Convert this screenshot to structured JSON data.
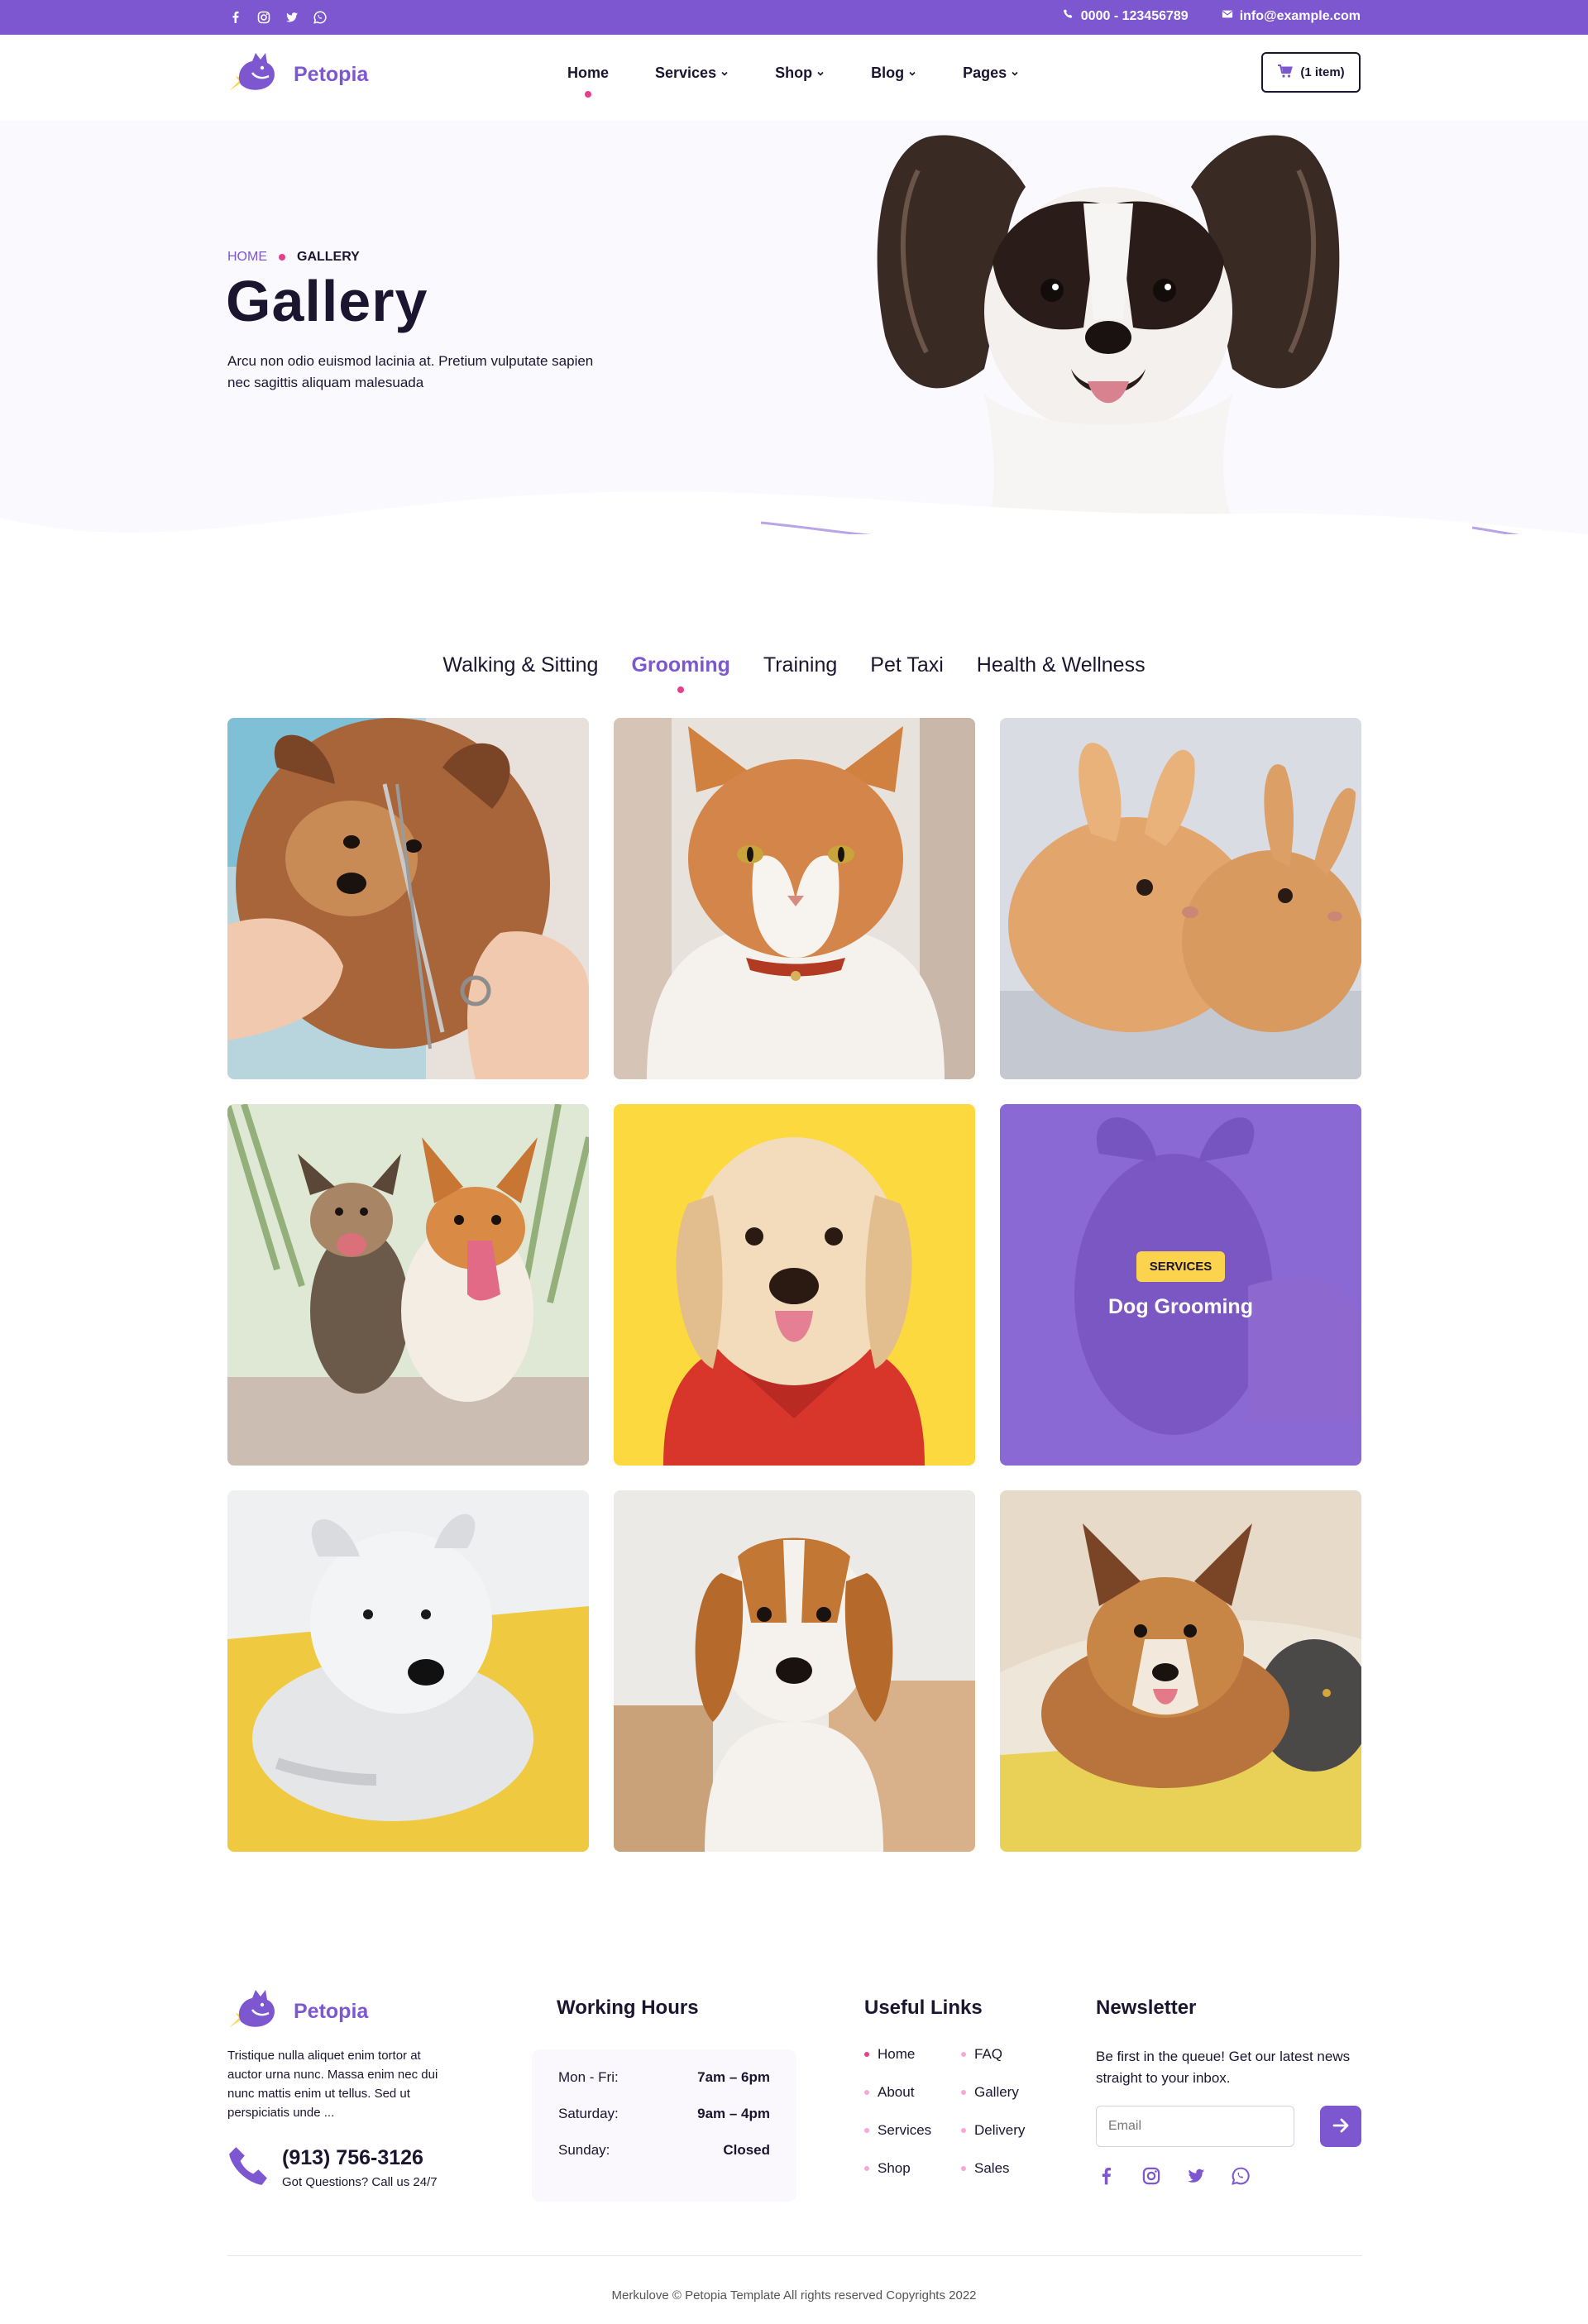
{
  "topbar": {
    "social_icons": [
      "facebook-icon",
      "instagram-icon",
      "twitter-icon",
      "whatsapp-icon"
    ],
    "phone": "0000 - 123456789",
    "email": "info@example.com",
    "bg_color": "#7d57d0"
  },
  "header": {
    "brand": "Petopia",
    "nav": [
      {
        "label": "Home",
        "active": true,
        "dropdown": false
      },
      {
        "label": "Services",
        "active": false,
        "dropdown": true
      },
      {
        "label": "Shop",
        "active": false,
        "dropdown": true
      },
      {
        "label": "Blog",
        "active": false,
        "dropdown": true
      },
      {
        "label": "Pages",
        "active": false,
        "dropdown": true
      }
    ],
    "cart_label": "(1 item)"
  },
  "hero": {
    "breadcrumb_home": "HOME",
    "breadcrumb_current": "GALLERY",
    "title": "Gallery",
    "description": "Arcu non odio euismod lacinia at. Pretium vulputate sapien nec sagittis aliquam malesuada"
  },
  "gallery": {
    "tabs": [
      "Walking & Sitting",
      "Grooming",
      "Training",
      "Pet Taxi",
      "Health & Wellness"
    ],
    "active_tab": "Grooming",
    "items": [
      {
        "alt": "yorkshire-terrier-grooming-photo"
      },
      {
        "alt": "ginger-white-cat-photo"
      },
      {
        "alt": "two-rabbits-photo"
      },
      {
        "alt": "two-small-dogs-running-photo"
      },
      {
        "alt": "golden-retriever-red-hoodie-photo"
      },
      {
        "alt": "dog-grooming-photo",
        "badge": "SERVICES",
        "title": "Dog Grooming"
      },
      {
        "alt": "white-terrier-on-yellow-sofa-photo"
      },
      {
        "alt": "beagle-sitting-photo"
      },
      {
        "alt": "corgi-with-cat-photo"
      }
    ]
  },
  "footer": {
    "brand": "Petopia",
    "description": "Tristique nulla aliquet enim tortor at auctor urna nunc. Massa enim nec dui nunc mattis enim ut tellus. Sed ut perspiciatis unde ...",
    "phone": "(913) 756-3126",
    "phone_sub": "Got Questions? Call us 24/7",
    "hours_title": "Working Hours",
    "hours": [
      {
        "day": "Mon - Fri:",
        "time": "7am – 6pm"
      },
      {
        "day": "Saturday:",
        "time": "9am – 4pm"
      },
      {
        "day": "Sunday:",
        "time": "Closed"
      }
    ],
    "links_title": "Useful Links",
    "links": [
      "Home",
      "FAQ",
      "About",
      "Gallery",
      "Services",
      "Delivery",
      "Shop",
      "Sales"
    ],
    "newsletter_title": "Newsletter",
    "newsletter_text": "Be first in the queue! Get our latest news straight to your inbox.",
    "email_placeholder": "Email",
    "social_icons": [
      "facebook-icon",
      "instagram-icon",
      "twitter-icon",
      "whatsapp-icon"
    ],
    "copyright": "Merkulove © Petopia Template All rights reserved Copyrights 2022"
  },
  "colors": {
    "accent": "#7d57d0",
    "pink": "#e83e8c",
    "badge": "#fcd34d",
    "text": "#1c1530"
  }
}
